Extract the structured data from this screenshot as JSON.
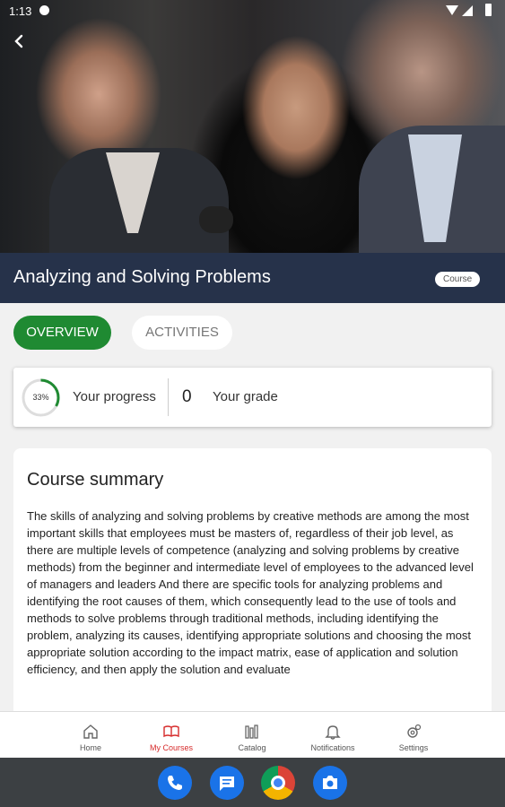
{
  "status_bar": {
    "time": "1:13"
  },
  "course": {
    "title": "Analyzing and Solving Problems",
    "badge": "Course"
  },
  "tabs": [
    {
      "label": "OVERVIEW",
      "active": true
    },
    {
      "label": "ACTIVITIES",
      "active": false
    }
  ],
  "progress": {
    "percent_label": "33%",
    "percent": 33,
    "label": "Your progress",
    "grade_value": "0",
    "grade_label": "Your grade"
  },
  "summary": {
    "title": "Course summary",
    "body": "The skills of analyzing and solving problems by creative methods are among the most important skills that employees must be masters of, regardless of their job level, as there are multiple levels of competence (analyzing and solving problems by creative methods) from the beginner and intermediate level of employees to the advanced level of managers and leaders And there are specific tools for analyzing problems and identifying the root causes of them, which consequently lead to the use of tools and methods to solve problems through traditional methods, including identifying the problem, analyzing its causes, identifying appropriate solutions and choosing the most appropriate solution according to the impact matrix, ease of application and solution efficiency, and then apply the solution and evaluate"
  },
  "bottom_nav": [
    {
      "label": "Home",
      "icon": "home-icon",
      "active": false
    },
    {
      "label": "My Courses",
      "icon": "book-icon",
      "active": true
    },
    {
      "label": "Catalog",
      "icon": "library-icon",
      "active": false
    },
    {
      "label": "Notifications",
      "icon": "bell-icon",
      "active": false
    },
    {
      "label": "Settings",
      "icon": "gear-icon",
      "active": false
    }
  ],
  "colors": {
    "title_bar": "#26324a",
    "accent_green": "#1f8a32",
    "active_nav": "#d62b2b"
  }
}
